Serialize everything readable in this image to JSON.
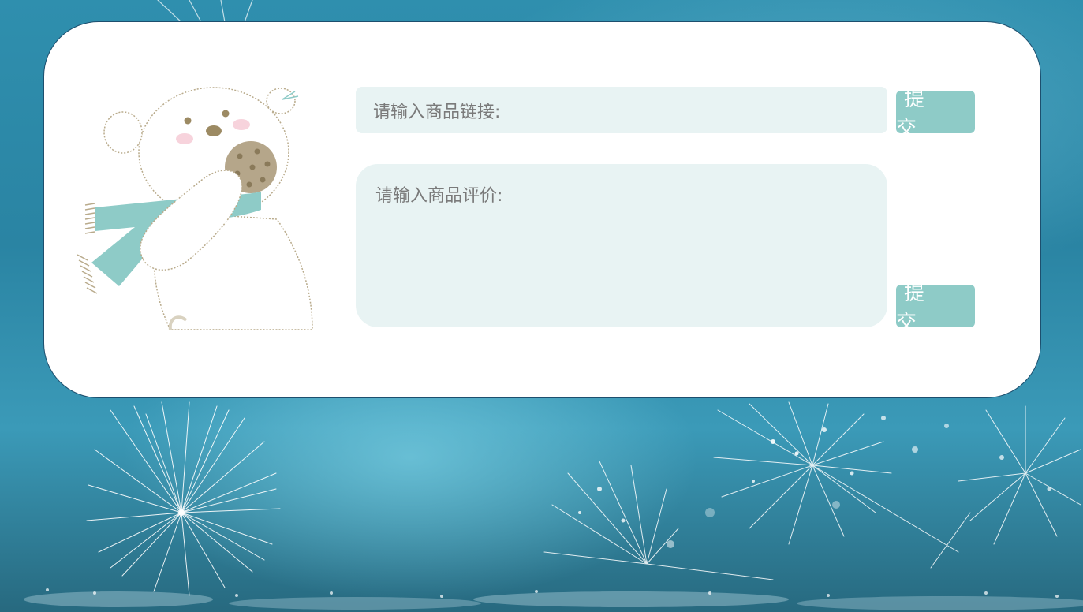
{
  "form": {
    "link_placeholder": "请输入商品链接:",
    "review_placeholder": "请输入商品评价:",
    "submit_link_label": "提 交",
    "submit_review_label": "提 交"
  },
  "colors": {
    "card_background": "#ffffff",
    "field_background": "#e8f3f3",
    "button_background": "#8ecbc7",
    "button_text": "#ffffff",
    "placeholder_text": "#7a7a7a"
  },
  "icons": {
    "mascot": "polar-bear-with-scarf-and-cookie",
    "background": "dandelion-seeds-with-water-drops"
  }
}
